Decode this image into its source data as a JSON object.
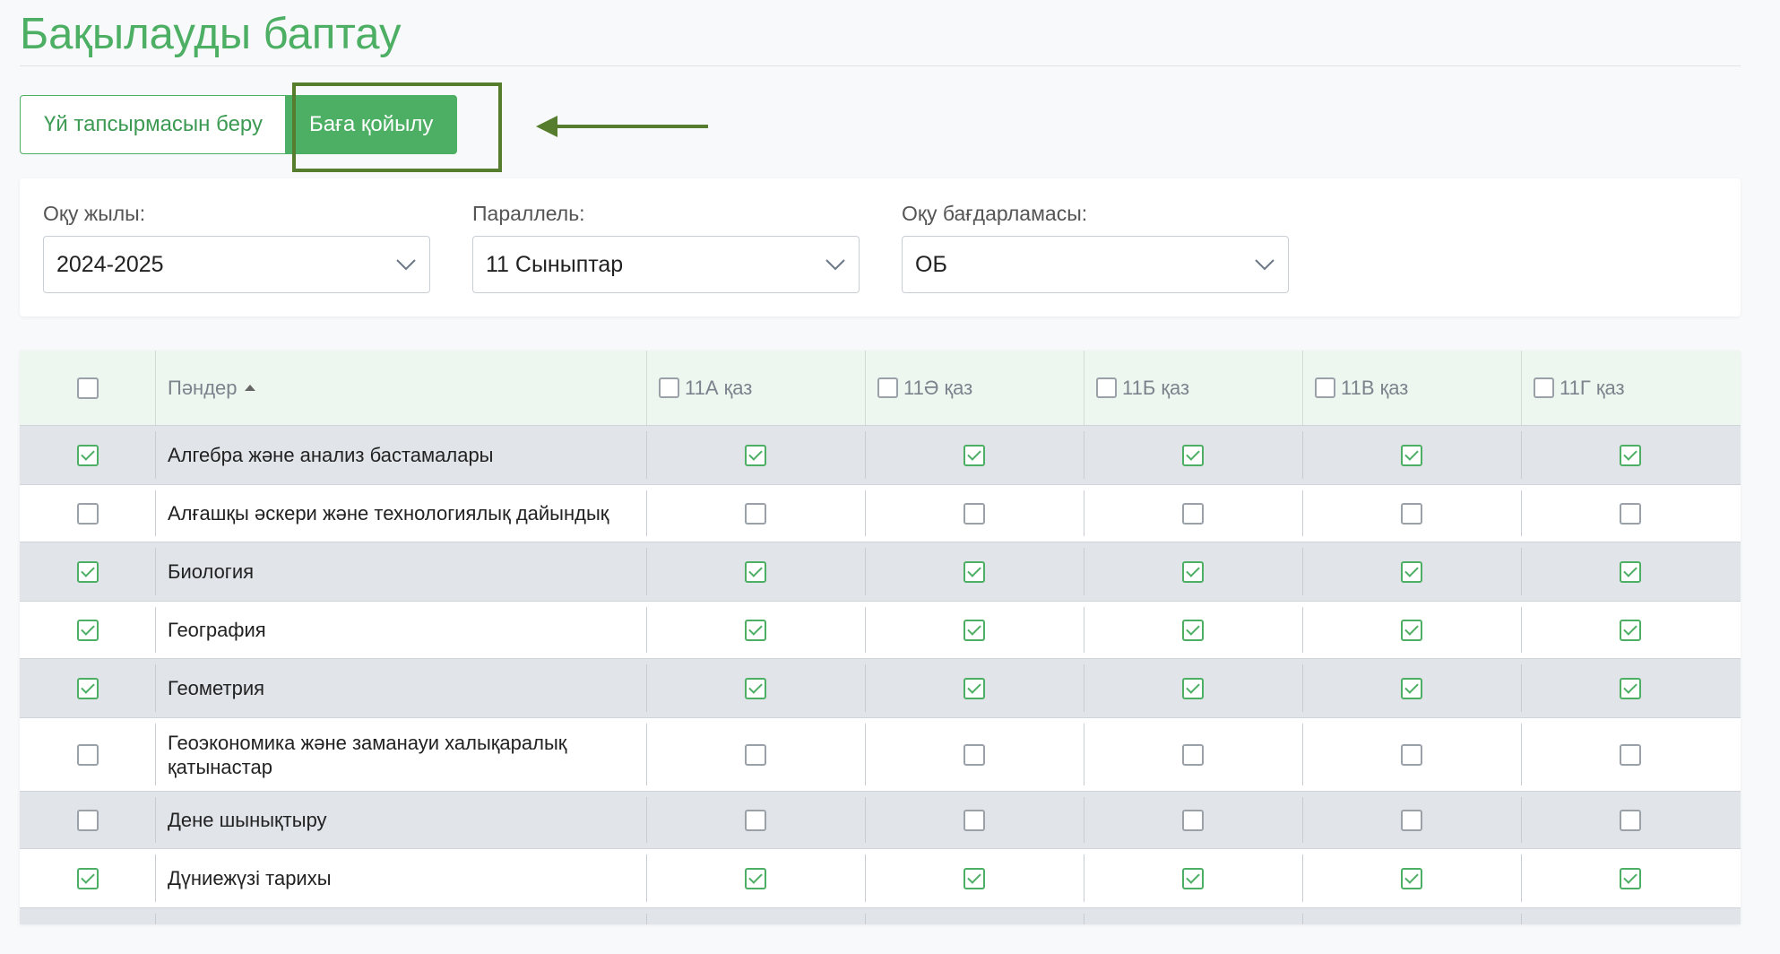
{
  "page": {
    "title": "Бақылауды баптау"
  },
  "tabs": [
    {
      "label": "Үй тапсырмасын беру",
      "active": false
    },
    {
      "label": "Баға қойылу",
      "active": true
    }
  ],
  "filters": {
    "year": {
      "label": "Оқу жылы:",
      "value": "2024-2025"
    },
    "parallel": {
      "label": "Параллель:",
      "value": "11 Сыныптар"
    },
    "program": {
      "label": "Оқу бағдарламасы:",
      "value": "ОБ"
    }
  },
  "table": {
    "subject_header": "Пәндер",
    "classes": [
      "11А қаз",
      "11Ә қаз",
      "11Б қаз",
      "11В қаз",
      "11Г қаз"
    ],
    "rows": [
      {
        "subject": "Алгебра және анализ бастамалары",
        "checked": true
      },
      {
        "subject": "Алғашқы әскери және технологиялық дайындық",
        "checked": false
      },
      {
        "subject": "Биология",
        "checked": true
      },
      {
        "subject": "География",
        "checked": true
      },
      {
        "subject": "Геометрия",
        "checked": true
      },
      {
        "subject": "Геоэкономика және заманауи халықаралық қатынастар",
        "checked": false
      },
      {
        "subject": "Дене шынықтыру",
        "checked": false
      },
      {
        "subject": "Дүниежүзі тарихы",
        "checked": true
      },
      {
        "subject": "",
        "checked": false
      }
    ]
  },
  "colors": {
    "accent": "#4caf63",
    "highlight": "#567d2e"
  }
}
